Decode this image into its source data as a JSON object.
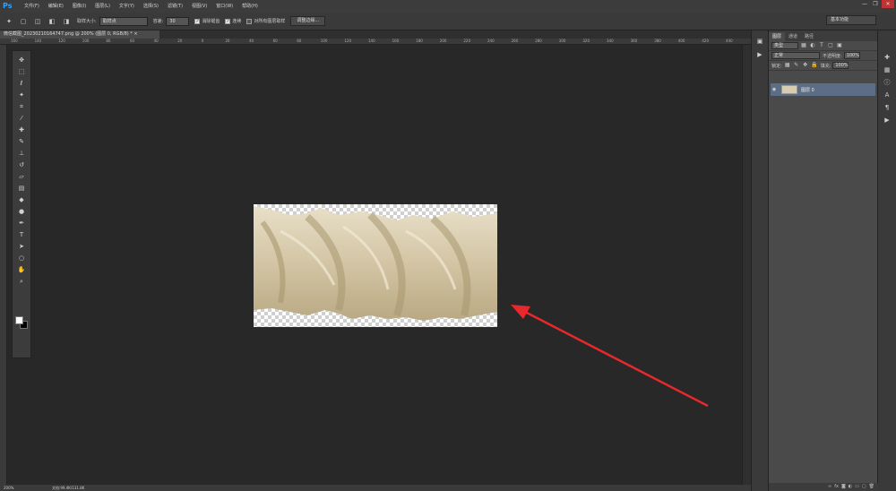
{
  "app": {
    "logo": "Ps"
  },
  "menu": [
    "文件(F)",
    "编辑(E)",
    "图像(I)",
    "图层(L)",
    "文字(Y)",
    "选择(S)",
    "滤镜(T)",
    "视图(V)",
    "窗口(W)",
    "帮助(H)"
  ],
  "window_controls": {
    "minimize": "—",
    "restore": "❐",
    "close": "✕"
  },
  "options": {
    "sample_size_label": "取样大小:",
    "sample_size_value": "取样点",
    "tolerance_label": "容差:",
    "tolerance_value": "30",
    "antialias_label": "消除锯齿",
    "contiguous_label": "连续",
    "all_layers_label": "对所有图层取样",
    "refine_edge_button": "调整边缘..."
  },
  "workspace": {
    "label": "基本功能"
  },
  "document": {
    "tab_title": "微信截图_20230210164747.png @ 200% (图层 0, RGB/8) * ×"
  },
  "ruler": {
    "ticks": [
      "160",
      "140",
      "120",
      "100",
      "80",
      "60",
      "40",
      "20",
      "0",
      "20",
      "40",
      "60",
      "80",
      "100",
      "120",
      "140",
      "160",
      "180",
      "200",
      "220",
      "240",
      "260",
      "280",
      "300",
      "320",
      "340",
      "360",
      "380",
      "400",
      "420",
      "440"
    ]
  },
  "status": {
    "zoom": "200%",
    "doc_size": "文档:99.4K/131.8K"
  },
  "layers": {
    "tabs": [
      "图层",
      "通道",
      "路径"
    ],
    "kind_filter": "类型",
    "blend_mode": "正常",
    "opacity_label": "不透明度:",
    "opacity_value": "100%",
    "lock_label": "锁定:",
    "fill_label": "填充:",
    "fill_value": "100%",
    "items": [
      {
        "name": "图层 0",
        "visible": true
      }
    ]
  },
  "colors": {
    "accent": "#2fa3ff",
    "canvas": "#282828",
    "selected_layer": "#5b6e86",
    "annotation_arrow": "#e8282b"
  }
}
